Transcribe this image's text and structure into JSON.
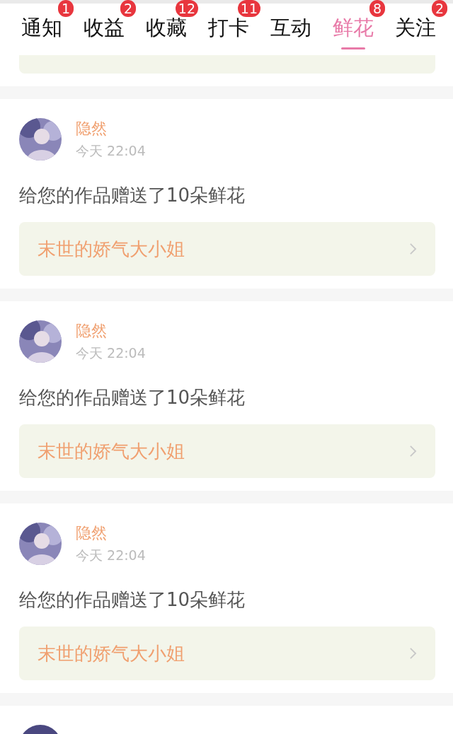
{
  "tabs": [
    {
      "label": "通知",
      "badge": "1",
      "selected": false
    },
    {
      "label": "收益",
      "badge": "2",
      "selected": false
    },
    {
      "label": "收藏",
      "badge": "12",
      "selected": false
    },
    {
      "label": "打卡",
      "badge": "11",
      "selected": false
    },
    {
      "label": "互动",
      "selected": false
    },
    {
      "label": "鲜花",
      "badge": "8",
      "selected": true
    },
    {
      "label": "关注",
      "badge": "2",
      "selected": false
    }
  ],
  "messages": [
    {
      "name": "隐然",
      "time": "今天 22:04",
      "text": "给您的作品赠送了10朵鲜花",
      "work": "末世的娇气大小姐"
    },
    {
      "name": "隐然",
      "time": "今天 22:04",
      "text": "给您的作品赠送了10朵鲜花",
      "work": "末世的娇气大小姐"
    },
    {
      "name": "隐然",
      "time": "今天 22:04",
      "text": "给您的作品赠送了10朵鲜花",
      "work": "末世的娇气大小姐"
    }
  ]
}
